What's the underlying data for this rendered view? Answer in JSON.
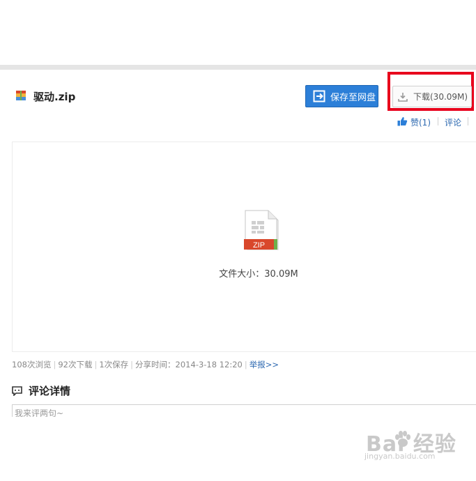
{
  "file": {
    "name": "驱动.zip",
    "size_text": "文件大小：30.09M",
    "badge": "ZIP"
  },
  "toolbar": {
    "save_label": "保存至网盘",
    "download_label": "下载(30.09M)"
  },
  "actions": {
    "like_label": "赞(1)",
    "comment_label": "评论"
  },
  "stats": {
    "views": "108次浏览",
    "downloads": "92次下载",
    "saves": "1次保存",
    "share_time": "分享时间：2014-3-18 12:20",
    "report": "举报>>"
  },
  "comments": {
    "title": "评论详情",
    "placeholder": "我来评两句~"
  },
  "watermark": {
    "brand": "Bai  经验",
    "url": "jingyan.baidu.com"
  },
  "colors": {
    "primary_blue": "#2c7fd8",
    "highlight_red": "#e8001c",
    "zip_red": "#d9472b",
    "link_blue": "#2c68b0"
  }
}
